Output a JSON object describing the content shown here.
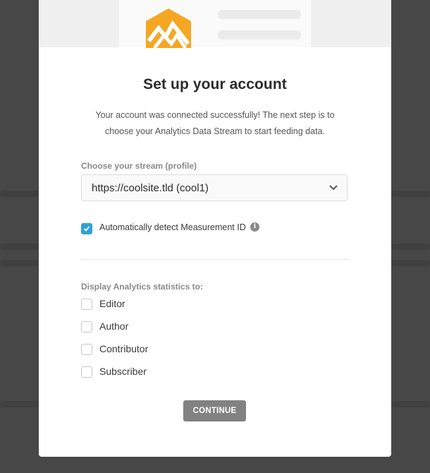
{
  "modal": {
    "title": "Set up your account",
    "subtitle_line1": "Your account was connected successfully! The next step is to",
    "subtitle_line2": "choose your Analytics Data Stream to start feeding data.",
    "stream_label": "Choose your stream (profile)",
    "stream_selected": "https://coolsite.tld (cool1)",
    "auto_detect_label": "Automatically detect Measurement ID",
    "auto_detect_checked": true,
    "display_label": "Display Analytics statistics to:",
    "roles": [
      {
        "label": "Editor",
        "checked": false
      },
      {
        "label": "Author",
        "checked": false
      },
      {
        "label": "Contributor",
        "checked": false
      },
      {
        "label": "Subscriber",
        "checked": false
      }
    ],
    "continue_label": "CONTINUE"
  },
  "colors": {
    "accent": "#2ea2d4",
    "logo_orange": "#f5a623",
    "button_gray": "#828282"
  },
  "icons": {
    "logo": "mountain-logo-icon",
    "chevron": "chevron-down-icon",
    "info": "info-icon",
    "check": "checkmark-icon"
  }
}
